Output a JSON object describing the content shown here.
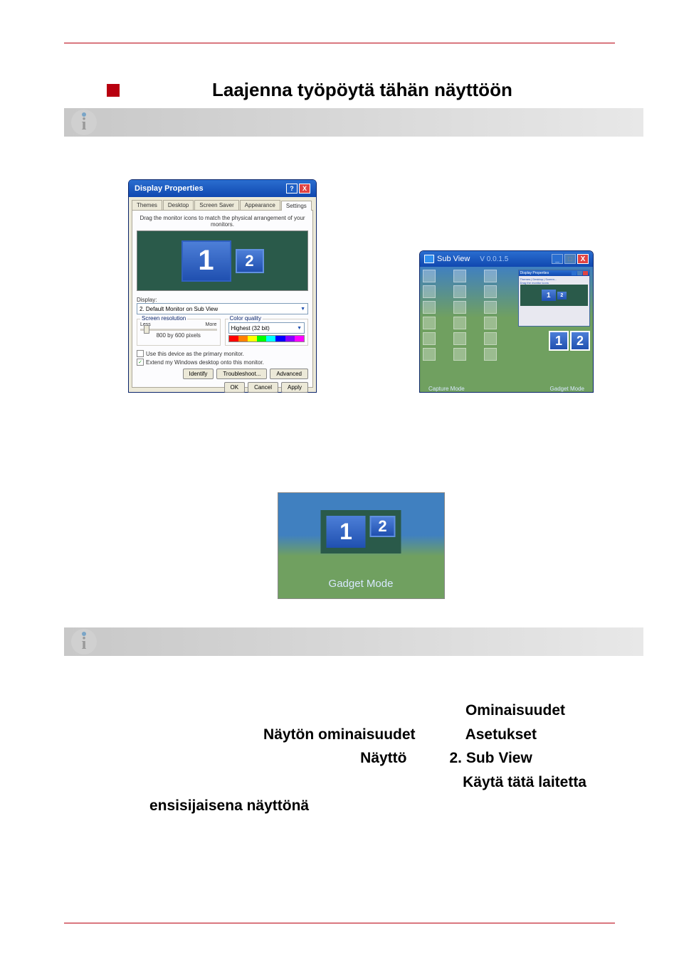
{
  "section": {
    "title": "Laajenna työpöytä tähän näyttöön"
  },
  "displayProps": {
    "titlebar": "Display Properties",
    "helpBtn": "?",
    "closeBtn": "X",
    "tabs": [
      "Themes",
      "Desktop",
      "Screen Saver",
      "Appearance",
      "Settings"
    ],
    "activeTabIndex": 4,
    "instruction": "Drag the monitor icons to match the physical arrangement of your monitors.",
    "mon1": "1",
    "mon2": "2",
    "displayLabel": "Display:",
    "displaySelected": "2. Default Monitor on Sub View",
    "resGroupLabel": "Screen resolution",
    "resLess": "Less",
    "resMore": "More",
    "resText": "800 by 600 pixels",
    "colorGroupLabel": "Color quality",
    "colorSelected": "Highest (32 bit)",
    "check1": "Use this device as the primary monitor.",
    "check2": "Extend my Windows desktop onto this monitor.",
    "check2Checked": "✓",
    "identifyBtn": "Identify",
    "troubleshootBtn": "Troubleshoot...",
    "advancedBtn": "Advanced",
    "okBtn": "OK",
    "cancelBtn": "Cancel",
    "applyBtn": "Apply"
  },
  "subView": {
    "title": "Sub View",
    "version": "V 0.0.1.5",
    "minBtn": "_",
    "maxBtn": "□",
    "closeBtn": "X",
    "miniTitle": "Display Properties",
    "miniBody1": "Themes | Desktop | Screen...",
    "miniBody2": "Drag the monitor icons",
    "mon1": "1",
    "mon2": "2",
    "miniMon1": "1",
    "miniMon2": "2",
    "rm1": "1",
    "rm2": "2",
    "captureLabel": "Capture Mode",
    "gadgetLabel": "Gadget Mode"
  },
  "gadget": {
    "mon1": "1",
    "mon2": "2",
    "label": "Gadget Mode"
  },
  "instructions": {
    "word_ominaisuudet": "Ominaisuudet",
    "word_nayton_om": "Näytön ominaisuudet",
    "word_asetukset": "Asetukset",
    "word_naytto": "Näyttö",
    "word_subview": "2. Sub View",
    "word_kayta": "Käytä tätä laitetta",
    "word_ensisij": "ensisijaisena näyttönä"
  }
}
